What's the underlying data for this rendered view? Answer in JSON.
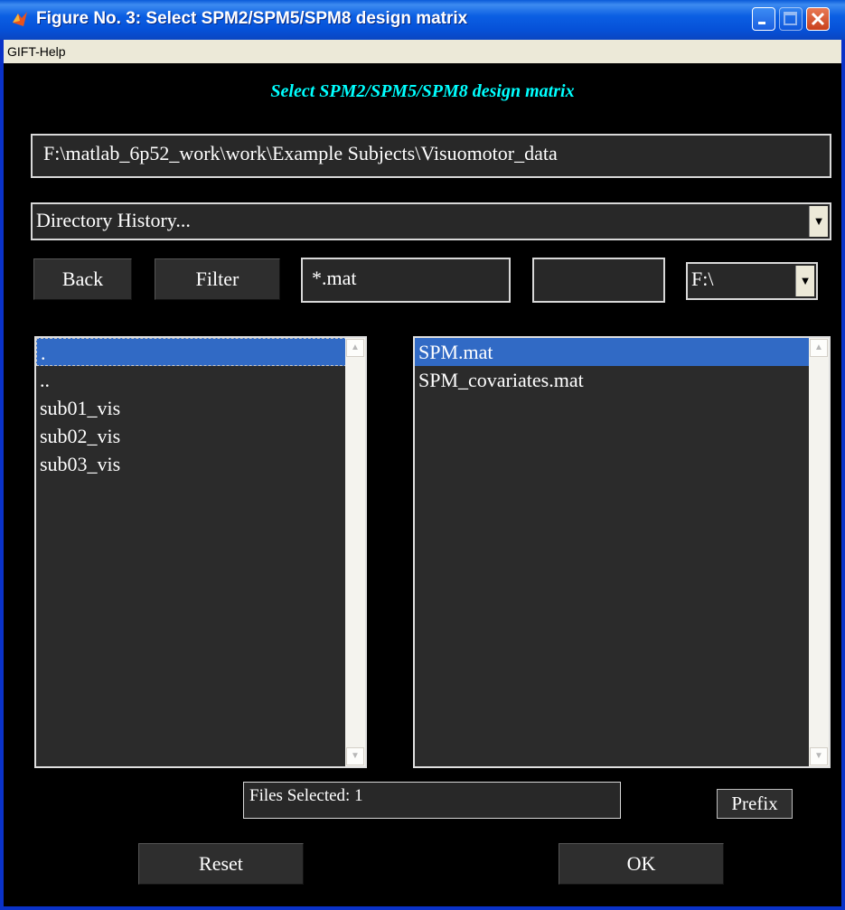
{
  "window": {
    "title": "Figure No. 3: Select SPM2/SPM5/SPM8 design matrix",
    "icons": {
      "app": "matlab-icon",
      "minimize": "minimize-icon",
      "maximize": "maximize-icon",
      "close": "close-icon"
    }
  },
  "menu": {
    "items": [
      "GIFT-Help"
    ]
  },
  "header": {
    "title": "Select SPM2/SPM5/SPM8 design matrix",
    "color": "#00ffff"
  },
  "path": {
    "value": "F:\\matlab_6p52_work\\work\\Example Subjects\\Visuomotor_data"
  },
  "directory_history": {
    "selected": "Directory History..."
  },
  "buttons": {
    "back": "Back",
    "filter": "Filter",
    "prefix": "Prefix",
    "reset": "Reset",
    "ok": "OK"
  },
  "filter_field": {
    "value": "*.mat"
  },
  "blank_field": {
    "value": ""
  },
  "drive": {
    "selected": "F:\\"
  },
  "directories": {
    "items": [
      ".",
      "..",
      "sub01_vis",
      "sub02_vis",
      "sub03_vis"
    ],
    "selected_index": 0
  },
  "files": {
    "items": [
      "SPM.mat",
      "SPM_covariates.mat"
    ],
    "selected_index": 0
  },
  "status": {
    "text": "Files Selected: 1"
  },
  "colors": {
    "selection": "#316ac5",
    "background": "#000000",
    "panel": "#2b2b2b",
    "titlebar": "#0b5fe3"
  }
}
